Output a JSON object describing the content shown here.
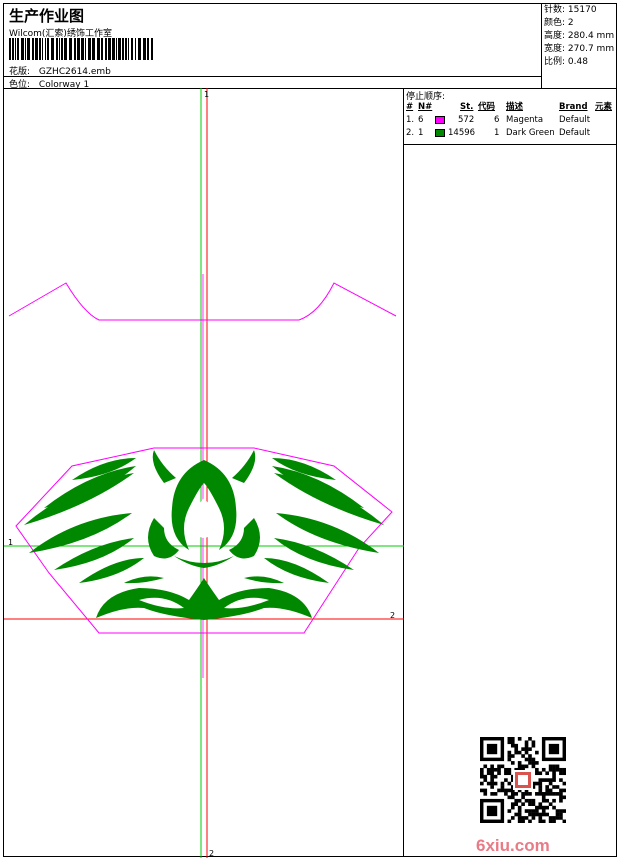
{
  "header": {
    "title": "生产作业图",
    "company": "Wilcom(汇索)绣饰工作室",
    "design_label": "花版:",
    "design_value": "GZHC2614.emb",
    "colorway_label": "色位:",
    "colorway_value": "Colorway 1"
  },
  "stats": [
    {
      "label": "针数:",
      "value": "15170"
    },
    {
      "label": "颜色:",
      "value": "2"
    },
    {
      "label": "高度:",
      "value": "280.4 mm"
    },
    {
      "label": "宽度:",
      "value": "270.7 mm"
    },
    {
      "label": "比例:",
      "value": "0.48"
    }
  ],
  "stop_sequence": {
    "title": "停止顺序:",
    "columns": [
      "#",
      "N#",
      "St.",
      "代码",
      "描述",
      "Brand",
      "元素"
    ],
    "rows": [
      {
        "index": "1.",
        "n": "6",
        "color": "#ff00ff",
        "stitches": "572",
        "code": "6",
        "desc": "Magenta",
        "brand": "Default"
      },
      {
        "index": "2.",
        "n": "1",
        "color": "#008800",
        "stitches": "14596",
        "code": "1",
        "desc": "Dark Green",
        "brand": "Default"
      }
    ]
  },
  "canvas": {
    "marker_top": "1",
    "marker_left": "1",
    "marker_right": "2",
    "marker_bottom": "2",
    "outline_color": "#ff00ff",
    "embroidery_color": "#008800",
    "guide_red": "#ff0000",
    "guide_green": "#00cc00"
  },
  "watermark": "6xiu.com"
}
